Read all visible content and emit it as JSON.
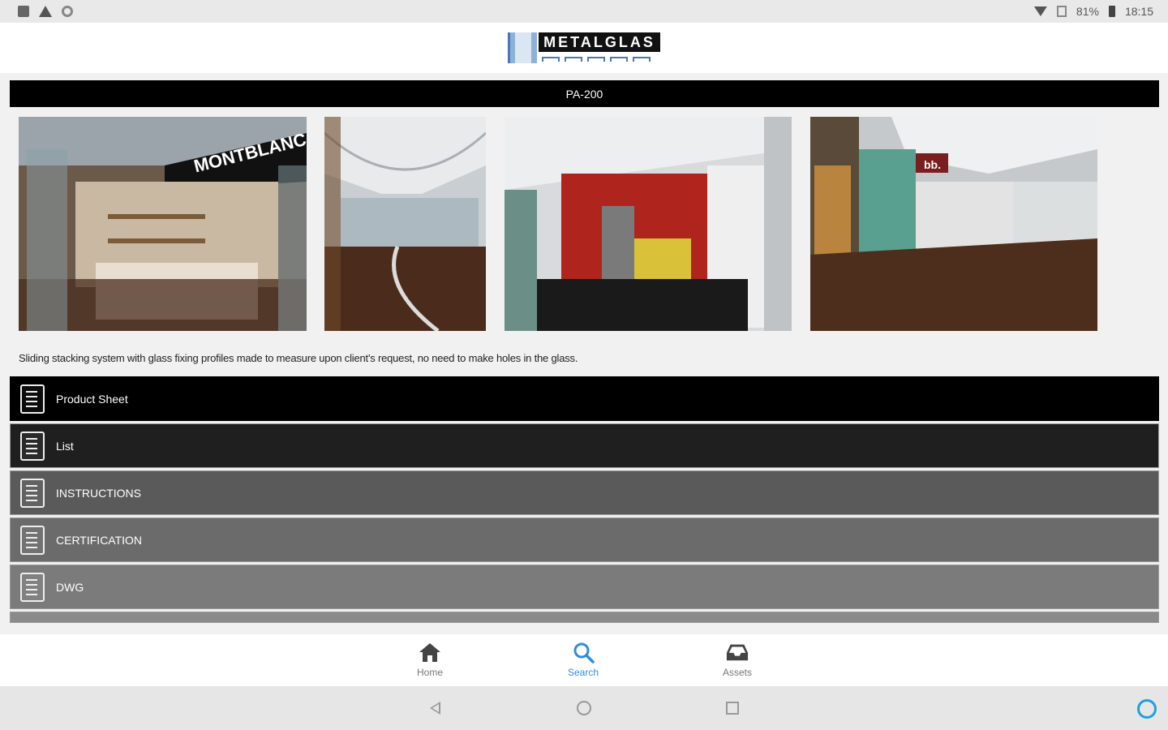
{
  "status_bar": {
    "battery": "81%",
    "time": "18:15"
  },
  "header": {
    "logo_text": "METALGLAS"
  },
  "product": {
    "title": "PA-200",
    "description": "Sliding stacking system with glass fixing profiles made to measure upon client's request, no need to make holes in the glass."
  },
  "gallery": [
    {
      "caption": "MONTBLANC"
    },
    {
      "caption": ""
    },
    {
      "caption": ""
    },
    {
      "caption": "bb."
    }
  ],
  "menu": [
    {
      "label": "Product Sheet",
      "icon": "document-gear-icon"
    },
    {
      "label": "List",
      "icon": "price-list-icon"
    },
    {
      "label": "INSTRUCTIONS",
      "icon": "instructions-icon"
    },
    {
      "label": "CERTIFICATION",
      "icon": "certificate-icon"
    },
    {
      "label": "DWG",
      "icon": "dwg-file-icon"
    }
  ],
  "tabs": [
    {
      "label": "Home",
      "icon": "home-icon"
    },
    {
      "label": "Search",
      "icon": "search-icon",
      "active": true
    },
    {
      "label": "Assets",
      "icon": "inbox-icon"
    }
  ],
  "colors": {
    "accent": "#2e8de0",
    "title_bar": "#000000"
  }
}
